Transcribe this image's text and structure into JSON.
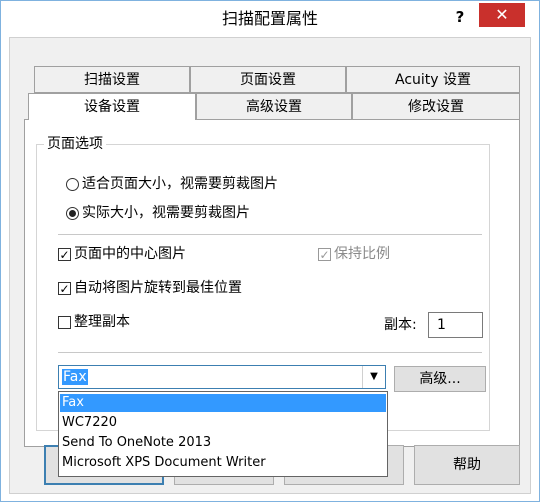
{
  "window": {
    "title": "扫描配置属性",
    "help_label": "?",
    "close_label": "✕"
  },
  "tabs": {
    "row1": [
      "扫描设置",
      "页面设置",
      "Acuity 设置"
    ],
    "row2": [
      "设备设置",
      "高级设置",
      "修改设置"
    ]
  },
  "page_options": {
    "title": "页面选项",
    "radio_fit": "适合页面大小，视需要剪裁图片",
    "radio_actual": "实际大小，视需要剪裁图片",
    "center_image": "页面中的中心图片",
    "keep_ratio": "保持比例",
    "auto_rotate": "自动将图片旋转到最佳位置",
    "collate": "整理副本",
    "copies_label": "副本:",
    "copies_value": "1"
  },
  "printer": {
    "selected": "Fax",
    "advanced_button": "高级...",
    "options": [
      "Fax",
      "WC7220",
      "Send To OneNote 2013",
      "Microsoft XPS Document Writer"
    ]
  },
  "footer": {
    "help_button": "帮助"
  }
}
